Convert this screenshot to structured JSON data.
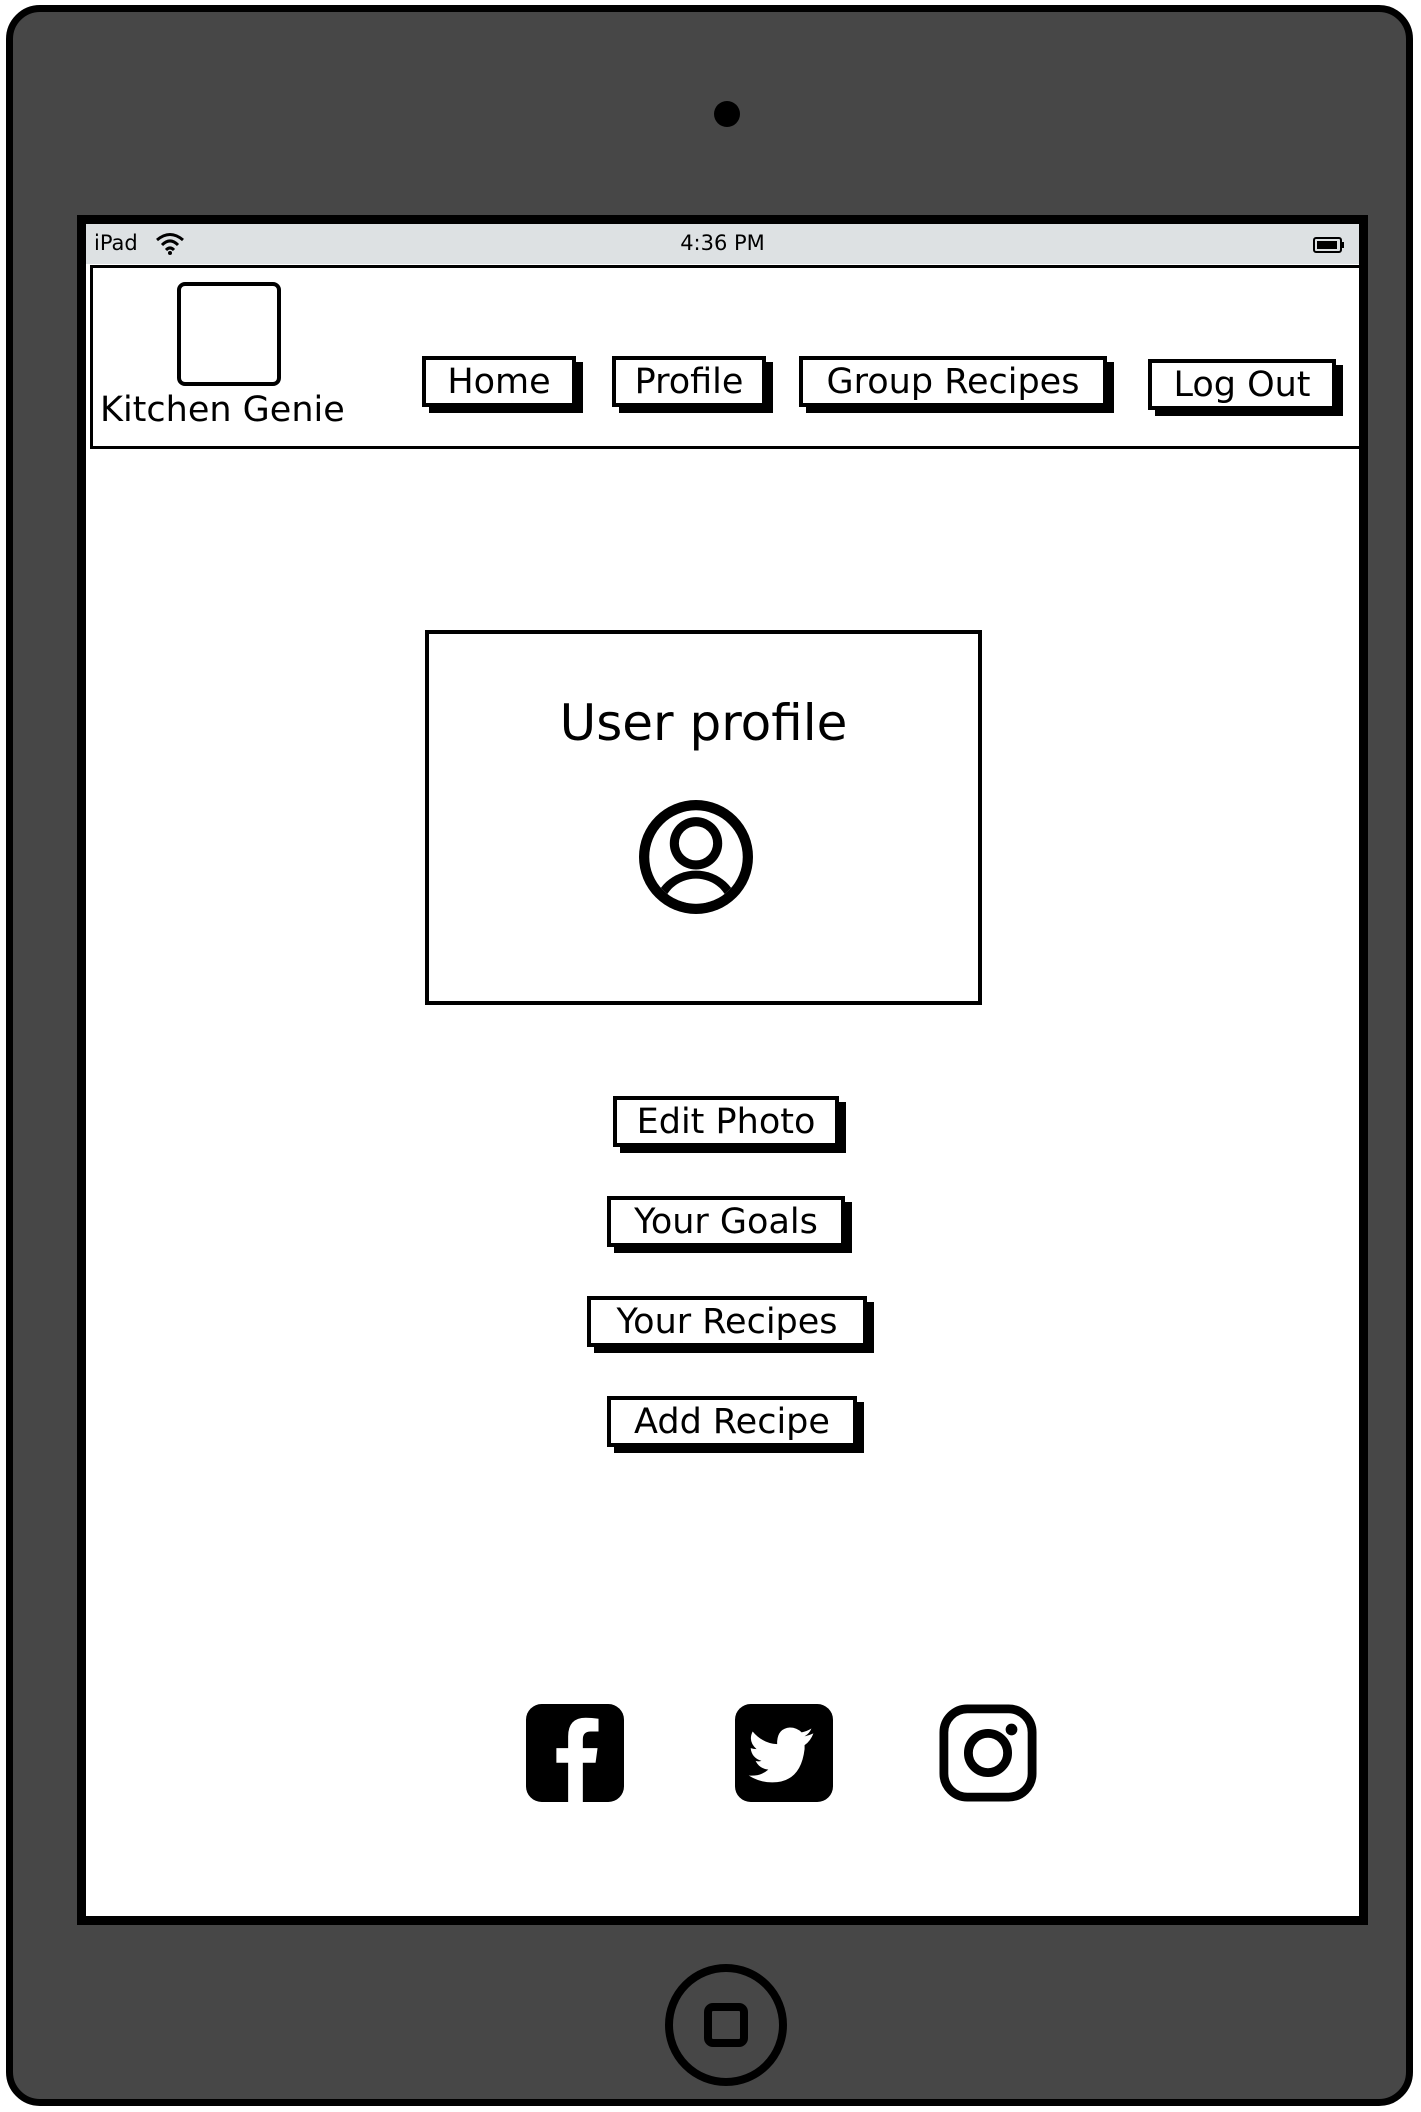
{
  "status_bar": {
    "device": "iPad",
    "time": "4:36 PM",
    "icons": [
      "wifi-icon",
      "battery-icon"
    ]
  },
  "navbar": {
    "brand": "Kitchen Genie",
    "logo": "logo-placeholder",
    "items": [
      {
        "label": "Home"
      },
      {
        "label": "Profile"
      },
      {
        "label": "Group Recipes"
      },
      {
        "label": "Log Out"
      }
    ]
  },
  "profile": {
    "title": "User profile",
    "avatar_icon": "user-avatar-icon"
  },
  "actions": [
    {
      "label": "Edit Photo"
    },
    {
      "label": "Your Goals"
    },
    {
      "label": "Your Recipes"
    },
    {
      "label": "Add Recipe"
    }
  ],
  "social": [
    "facebook-icon",
    "twitter-icon",
    "instagram-icon"
  ],
  "colors": {
    "device_frame": "#474747",
    "status_bar": "#dde1e3",
    "ink": "#000000",
    "screen": "#ffffff"
  }
}
